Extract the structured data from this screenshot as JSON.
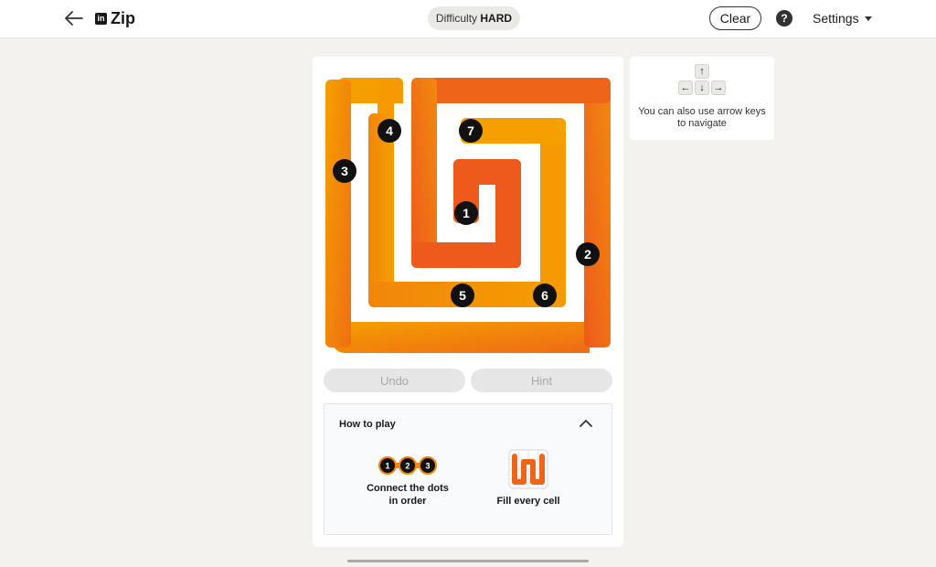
{
  "header": {
    "back_icon": "back-arrow-icon",
    "brand_logo_text": "in",
    "brand_name": "Zip",
    "difficulty_label": "Difficulty",
    "difficulty_value": "HARD",
    "clear_label": "Clear",
    "help_icon": "help-icon",
    "help_glyph": "?",
    "settings_label": "Settings"
  },
  "board": {
    "path_colors": {
      "light": "#f5a000",
      "dark": "#ee5a1c"
    },
    "dots": [
      "1",
      "2",
      "3",
      "4",
      "5",
      "6",
      "7"
    ]
  },
  "controls": {
    "undo_label": "Undo",
    "hint_label": "Hint"
  },
  "how_to_play": {
    "title": "How to play",
    "rule1_dots": [
      "1",
      "2",
      "3"
    ],
    "rule1_text": "Connect the dots in order",
    "rule2_text": "Fill every cell"
  },
  "tip": {
    "keys": [
      "↑",
      "←",
      "↓",
      "→"
    ],
    "text": "You can also use arrow keys to navigate"
  }
}
